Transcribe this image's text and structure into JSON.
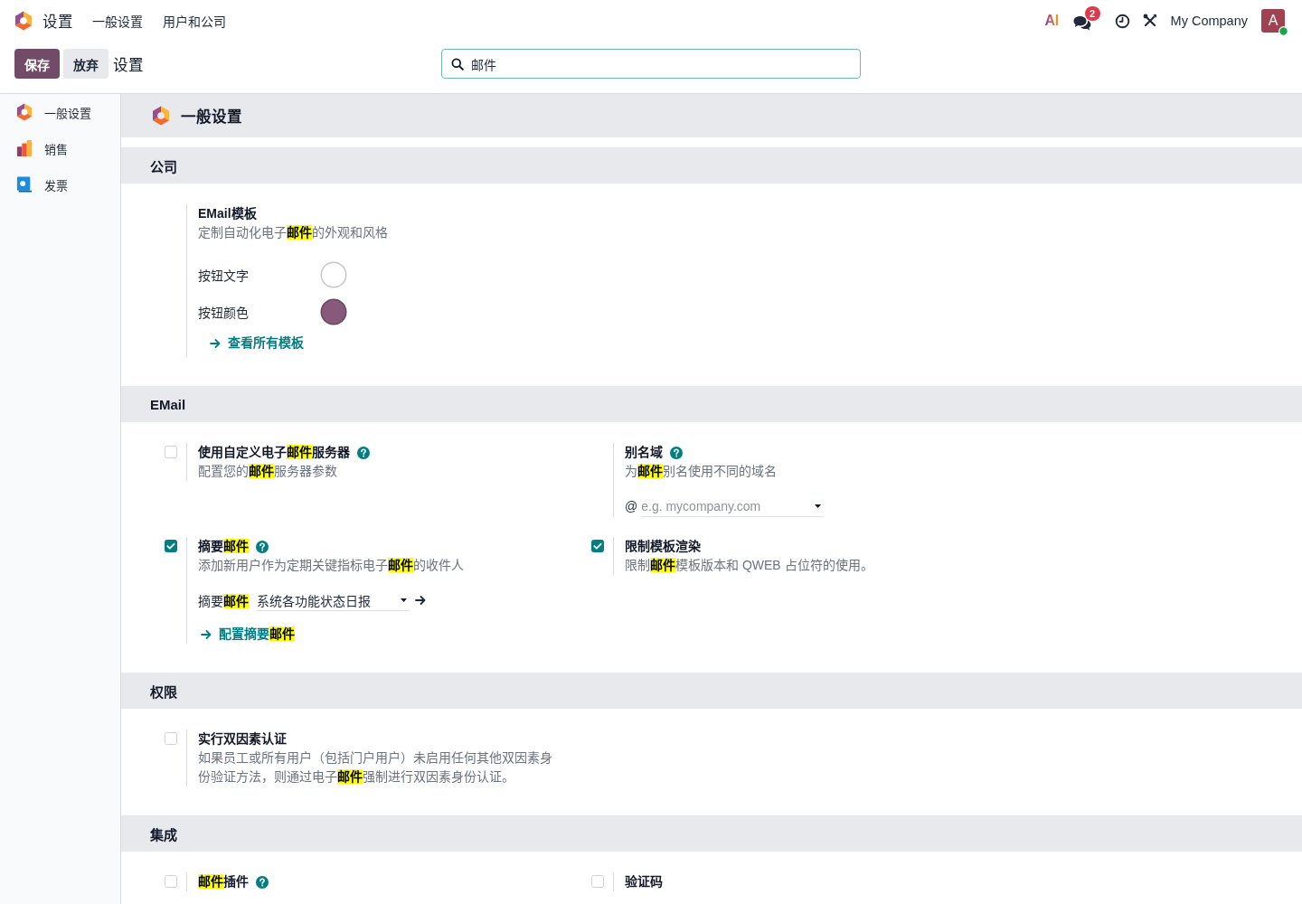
{
  "topbar": {
    "app_title": "设置",
    "menu": [
      {
        "label": "一般设置"
      },
      {
        "label": "用户和公司"
      }
    ],
    "ai_label": "AI",
    "chat_badge": "2",
    "company": "My Company",
    "avatar": {
      "initial": "A",
      "online": true
    }
  },
  "control_panel": {
    "buttons": [
      {
        "label": "保存",
        "kind": "primary"
      },
      {
        "label": "放弃",
        "kind": "secondary"
      }
    ],
    "breadcrumb": "设置",
    "search": {
      "value": "邮件"
    }
  },
  "sidebar": {
    "items": [
      {
        "label": "一般设置",
        "kind": "settings",
        "selected": false
      },
      {
        "label": "销售",
        "kind": "sales",
        "selected": false
      },
      {
        "label": "发票",
        "kind": "invoicing",
        "selected": false
      }
    ]
  },
  "page_header": {
    "title": "一般设置"
  },
  "sections": [
    {
      "title": "公司",
      "settings": [
        {
          "kind": "plain",
          "title": "EMail模板",
          "description": "定制自动化电子**邮件**的外观和风格",
          "colors": [
            {
              "label": "按钮文字",
              "color": "#ffffff"
            },
            {
              "label": "按钮颜色",
              "color": "#875a7b"
            }
          ],
          "link": "查看所有模板"
        }
      ]
    },
    {
      "title": "EMail",
      "settings": [
        {
          "kind": "checkbox",
          "checked": false,
          "title": "使用自定义电子**邮件**服务器",
          "help": true,
          "description": "配置您的**邮件**服务器参数"
        },
        {
          "kind": "plain",
          "title": "别名域",
          "help": true,
          "description": "为**邮件**别名使用不同的域名",
          "field": {
            "prefix": "@",
            "placeholder": "e.g. mycompany.com"
          }
        },
        {
          "kind": "checkbox",
          "checked": true,
          "title": "摘要**邮件**",
          "help": true,
          "description": "添加新用户作为定期关键指标电子**邮件**的收件人",
          "select": {
            "label": "摘要**邮件**",
            "value": "系统各功能状态日报"
          },
          "link": "配置摘要**邮件**"
        },
        {
          "kind": "checkbox",
          "checked": true,
          "title": "限制模板渲染",
          "description": "限制**邮件**模板版本和 QWEB 占位符的使用。"
        }
      ]
    },
    {
      "title": "权限",
      "settings": [
        {
          "kind": "checkbox",
          "checked": false,
          "title": "实行双因素认证",
          "description": "如果员工或所有用户（包括门户用户）未启用任何其他双因素身份验证方法，则通过电子**邮件**强制进行双因素身份认证。"
        }
      ]
    },
    {
      "title": "集成",
      "settings": [
        {
          "kind": "checkbox",
          "checked": false,
          "title": "**邮件**插件",
          "help": true
        },
        {
          "kind": "checkbox",
          "checked": false,
          "title": "验证码"
        }
      ]
    }
  ]
}
